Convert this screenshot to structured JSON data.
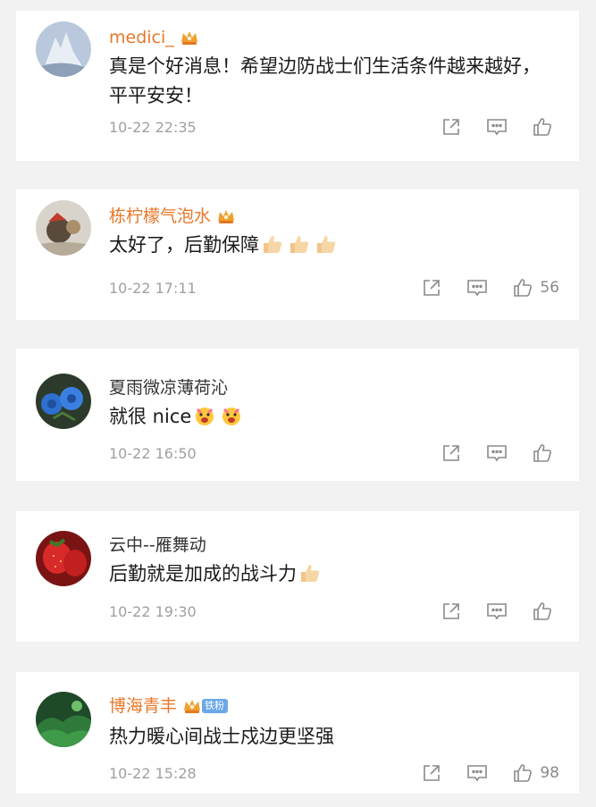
{
  "comments": [
    {
      "username": "medici_",
      "vip": true,
      "text": "真是个好消息！希望边防战士们生活条件越来越好，平平安安！",
      "time": "10-22 22:35",
      "likes": ""
    },
    {
      "username": "栋柠檬气泡水",
      "vip": true,
      "text": "太好了，后勤保障",
      "emoji": [
        "thumbs-up-emoji",
        "thumbs-up-emoji",
        "thumbs-up-emoji"
      ],
      "time": "10-22 17:11",
      "likes": "56"
    },
    {
      "username": "夏雨微凉薄荷沁",
      "vip": false,
      "text": "就很 nice",
      "emoji": [
        "excited-face-emoji",
        "excited-face-emoji"
      ],
      "time": "10-22 16:50",
      "likes": ""
    },
    {
      "username": "云中--雁舞动",
      "vip": false,
      "text": "后勤就是加成的战斗力",
      "emoji": [
        "thumbs-up-emoji"
      ],
      "time": "10-22 19:30",
      "likes": ""
    },
    {
      "username": "博海青丰",
      "vip": true,
      "fan_badge": "铁粉",
      "text": "热力暖心间战士戍边更坚强",
      "time": "10-22 15:28",
      "likes": "98"
    }
  ],
  "icons": {
    "share": "share-icon",
    "comment": "comment-icon",
    "like": "like-icon"
  },
  "colors": {
    "vip_name": "#e8782a",
    "plain_name": "#333333",
    "time": "#a0a0a0",
    "background": "#f2f2f2"
  }
}
